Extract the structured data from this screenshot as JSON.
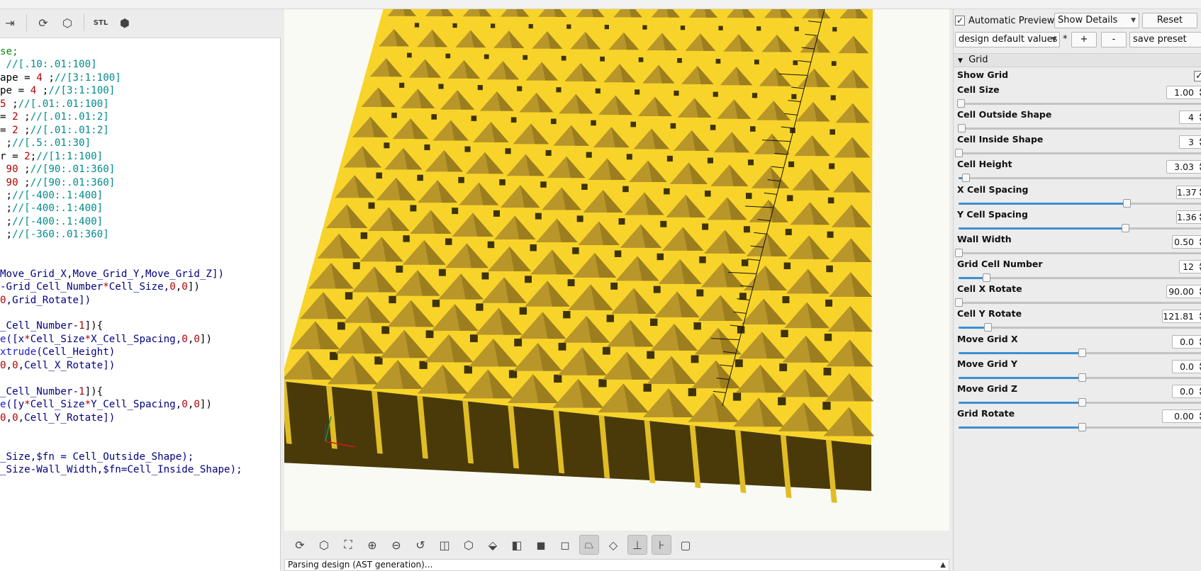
{
  "toolbar": {
    "icons": [
      "indent-icon",
      "preview-icon",
      "render-icon",
      "export-stl-icon",
      "send-to-print-icon"
    ],
    "stl_label": "STL"
  },
  "editor": {
    "lines": [
      [
        {
          "t": "se;",
          "c": "kw"
        }
      ],
      [
        {
          "t": " ",
          "c": ""
        },
        {
          "t": "//[.10:.01:100]",
          "c": "cm"
        }
      ],
      [
        {
          "t": "ape = ",
          "c": ""
        },
        {
          "t": "4",
          "c": "num"
        },
        {
          "t": " ;",
          "c": ""
        },
        {
          "t": "//[3:1:100]",
          "c": "cm"
        }
      ],
      [
        {
          "t": "pe = ",
          "c": ""
        },
        {
          "t": "4",
          "c": "num"
        },
        {
          "t": " ;",
          "c": ""
        },
        {
          "t": "//[3:1:100]",
          "c": "cm"
        }
      ],
      [
        {
          "t": "5",
          "c": "num"
        },
        {
          "t": " ;",
          "c": ""
        },
        {
          "t": "//[.01:.01:100]",
          "c": "cm"
        }
      ],
      [
        {
          "t": "= ",
          "c": ""
        },
        {
          "t": "2",
          "c": "num"
        },
        {
          "t": " ;",
          "c": ""
        },
        {
          "t": "//[.01:.01:2]",
          "c": "cm"
        }
      ],
      [
        {
          "t": "= ",
          "c": ""
        },
        {
          "t": "2",
          "c": "num"
        },
        {
          "t": " ;",
          "c": ""
        },
        {
          "t": "//[.01:.01:2]",
          "c": "cm"
        }
      ],
      [
        {
          "t": " ;",
          "c": ""
        },
        {
          "t": "//[.5:.01:30]",
          "c": "cm"
        }
      ],
      [
        {
          "t": "r = ",
          "c": ""
        },
        {
          "t": "2",
          "c": "num"
        },
        {
          "t": ";",
          "c": ""
        },
        {
          "t": "//[1:1:100]",
          "c": "cm"
        }
      ],
      [
        {
          "t": " ",
          "c": ""
        },
        {
          "t": "90",
          "c": "num"
        },
        {
          "t": " ;",
          "c": ""
        },
        {
          "t": "//[90:.01:360]",
          "c": "cm"
        }
      ],
      [
        {
          "t": " ",
          "c": ""
        },
        {
          "t": "90",
          "c": "num"
        },
        {
          "t": " ;",
          "c": ""
        },
        {
          "t": "//[90:.01:360]",
          "c": "cm"
        }
      ],
      [
        {
          "t": " ;",
          "c": ""
        },
        {
          "t": "//[-400:.1:400]",
          "c": "cm"
        }
      ],
      [
        {
          "t": " ;",
          "c": ""
        },
        {
          "t": "//[-400:.1:400]",
          "c": "cm"
        }
      ],
      [
        {
          "t": " ;",
          "c": ""
        },
        {
          "t": "//[-400:.1:400]",
          "c": "cm"
        }
      ],
      [
        {
          "t": " ;",
          "c": ""
        },
        {
          "t": "//[-360:.01:360]",
          "c": "cm"
        }
      ],
      [
        {
          "t": "",
          "c": ""
        }
      ],
      [
        {
          "t": "",
          "c": ""
        }
      ],
      [
        {
          "t": "Move_Grid_X,Move_Grid_Y,Move_Grid_Z])",
          "c": "id"
        }
      ],
      [
        {
          "t": "-Grid_Cell_Number",
          "c": "id"
        },
        {
          "t": "*",
          "c": "num"
        },
        {
          "t": "Cell_Size,",
          "c": "id"
        },
        {
          "t": "0",
          "c": "num"
        },
        {
          "t": ",",
          "c": ""
        },
        {
          "t": "0",
          "c": "num"
        },
        {
          "t": "])",
          "c": ""
        }
      ],
      [
        {
          "t": "0",
          "c": "num"
        },
        {
          "t": ",Grid_Rotate])",
          "c": "id"
        }
      ],
      [
        {
          "t": "",
          "c": ""
        }
      ],
      [
        {
          "t": "_Cell_Number-",
          "c": "id"
        },
        {
          "t": "1",
          "c": "num"
        },
        {
          "t": "]){",
          "c": ""
        }
      ],
      [
        {
          "t": "e",
          "c": "fn"
        },
        {
          "t": "([x",
          "c": "id"
        },
        {
          "t": "*",
          "c": "num"
        },
        {
          "t": "Cell_Size",
          "c": "id"
        },
        {
          "t": "*",
          "c": "num"
        },
        {
          "t": "X_Cell_Spacing,",
          "c": "id"
        },
        {
          "t": "0",
          "c": "num"
        },
        {
          "t": ",",
          "c": ""
        },
        {
          "t": "0",
          "c": "num"
        },
        {
          "t": "])",
          "c": ""
        }
      ],
      [
        {
          "t": "xtrude",
          "c": "fn"
        },
        {
          "t": "(Cell_Height)",
          "c": "id"
        }
      ],
      [
        {
          "t": "0",
          "c": "num"
        },
        {
          "t": ",",
          "c": ""
        },
        {
          "t": "0",
          "c": "num"
        },
        {
          "t": ",Cell_X_Rotate])",
          "c": "id"
        }
      ],
      [
        {
          "t": "",
          "c": ""
        }
      ],
      [
        {
          "t": "_Cell_Number-",
          "c": "id"
        },
        {
          "t": "1",
          "c": "num"
        },
        {
          "t": "]){",
          "c": ""
        }
      ],
      [
        {
          "t": "e",
          "c": "fn"
        },
        {
          "t": "([y",
          "c": "id"
        },
        {
          "t": "*",
          "c": "num"
        },
        {
          "t": "Cell_Size",
          "c": "id"
        },
        {
          "t": "*",
          "c": "num"
        },
        {
          "t": "Y_Cell_Spacing,",
          "c": "id"
        },
        {
          "t": "0",
          "c": "num"
        },
        {
          "t": ",",
          "c": ""
        },
        {
          "t": "0",
          "c": "num"
        },
        {
          "t": "])",
          "c": ""
        }
      ],
      [
        {
          "t": "0",
          "c": "num"
        },
        {
          "t": ",",
          "c": ""
        },
        {
          "t": "0",
          "c": "num"
        },
        {
          "t": ",Cell_Y_Rotate])",
          "c": "id"
        }
      ],
      [
        {
          "t": "",
          "c": ""
        }
      ],
      [
        {
          "t": "",
          "c": ""
        }
      ],
      [
        {
          "t": "_Size,$fn = Cell_Outside_Shape);",
          "c": "id"
        }
      ],
      [
        {
          "t": "_Size-Wall_Width,$fn=Cell_Inside_Shape);",
          "c": "id"
        }
      ]
    ]
  },
  "viewport": {
    "colors": {
      "top": "#f8d42a",
      "pyramid": "#b8962a",
      "hole": "#3f330c",
      "side": "#4a3a0a",
      "edge": "#e0bd25"
    }
  },
  "view_toolbar": {
    "icons": [
      "preview-icon",
      "render-icon",
      "view-all-icon",
      "zoom-in-icon",
      "zoom-out-icon",
      "reset-view-icon",
      "view-right-icon",
      "view-top-icon",
      "view-bottom-icon",
      "view-left-icon",
      "view-front-icon",
      "view-back-icon",
      "perspective-icon",
      "orthogonal-icon",
      "show-axes-icon",
      "show-scale-markers-icon",
      "show-edges-icon"
    ]
  },
  "status": {
    "text": "Parsing design (AST generation)..."
  },
  "customizer": {
    "automatic_preview_label": "Automatic Preview",
    "automatic_preview_checked": "✓",
    "details_select": "Show Details",
    "reset_label": "Reset",
    "preset_select": "design default values",
    "asterisk": "*",
    "plus_label": "+",
    "minus_label": "-",
    "save_preset_label": "save preset",
    "group_title": "Grid",
    "show_grid": {
      "label": "Show Grid",
      "checked": "✓"
    },
    "params": [
      {
        "label": "Cell Size",
        "value": "1.00",
        "min": 0.1,
        "max": 100,
        "v": 1.0
      },
      {
        "label": "Cell Outside Shape",
        "value": "4",
        "min": 3,
        "max": 100,
        "v": 4
      },
      {
        "label": "Cell Inside Shape",
        "value": "3",
        "min": 3,
        "max": 100,
        "v": 3
      },
      {
        "label": "Cell Height",
        "value": "3.03",
        "min": 0.01,
        "max": 100,
        "v": 3.03
      },
      {
        "label": "X Cell Spacing",
        "value": "1.37",
        "min": 0.01,
        "max": 2,
        "v": 1.37
      },
      {
        "label": "Y Cell Spacing",
        "value": "1.36",
        "min": 0.01,
        "max": 2,
        "v": 1.36
      },
      {
        "label": "Wall Width",
        "value": "0.50",
        "min": 0.5,
        "max": 30,
        "v": 0.5
      },
      {
        "label": "Grid Cell Number",
        "value": "12",
        "min": 1,
        "max": 100,
        "v": 12
      },
      {
        "label": "Cell X Rotate",
        "value": "90.00",
        "min": 90,
        "max": 360,
        "v": 90
      },
      {
        "label": "Cell Y Rotate",
        "value": "121.81",
        "min": 90,
        "max": 360,
        "v": 121.81
      },
      {
        "label": "Move Grid X",
        "value": "0.0",
        "min": -400,
        "max": 400,
        "v": 0
      },
      {
        "label": "Move Grid Y",
        "value": "0.0",
        "min": -400,
        "max": 400,
        "v": 0
      },
      {
        "label": "Move Grid Z",
        "value": "0.0",
        "min": -400,
        "max": 400,
        "v": 0
      },
      {
        "label": "Grid Rotate",
        "value": "0.00",
        "min": -360,
        "max": 360,
        "v": 0
      }
    ]
  }
}
